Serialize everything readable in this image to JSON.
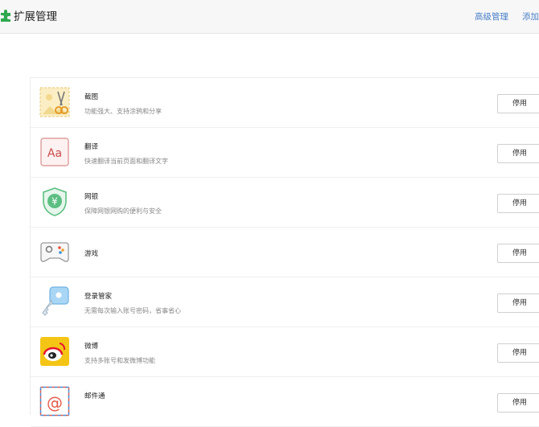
{
  "header": {
    "title": "扩展管理",
    "advanced_label": "高级管理",
    "add_label": "添加"
  },
  "extensions": [
    {
      "name": "截图",
      "desc": "功能强大、支持涂鸦和分享",
      "button": "停用",
      "icon": "screenshot-icon"
    },
    {
      "name": "翻译",
      "desc": "快速翻译当前页面和翻译文字",
      "button": "停用",
      "icon": "translate-icon"
    },
    {
      "name": "网银",
      "desc": "保障网银网购的便利与安全",
      "button": "停用",
      "icon": "bank-shield-icon"
    },
    {
      "name": "游戏",
      "desc": "",
      "button": "停用",
      "icon": "gamepad-icon"
    },
    {
      "name": "登录管家",
      "desc": "无需每次输入账号密码，省事省心",
      "button": "停用",
      "icon": "key-icon"
    },
    {
      "name": "微博",
      "desc": "支持多账号和发微博功能",
      "button": "停用",
      "icon": "weibo-icon"
    },
    {
      "name": "邮件通",
      "desc": "",
      "button": "停用",
      "icon": "mail-icon"
    }
  ],
  "colors": {
    "link": "#4a7fc7",
    "logo_green": "#2fa84f"
  }
}
